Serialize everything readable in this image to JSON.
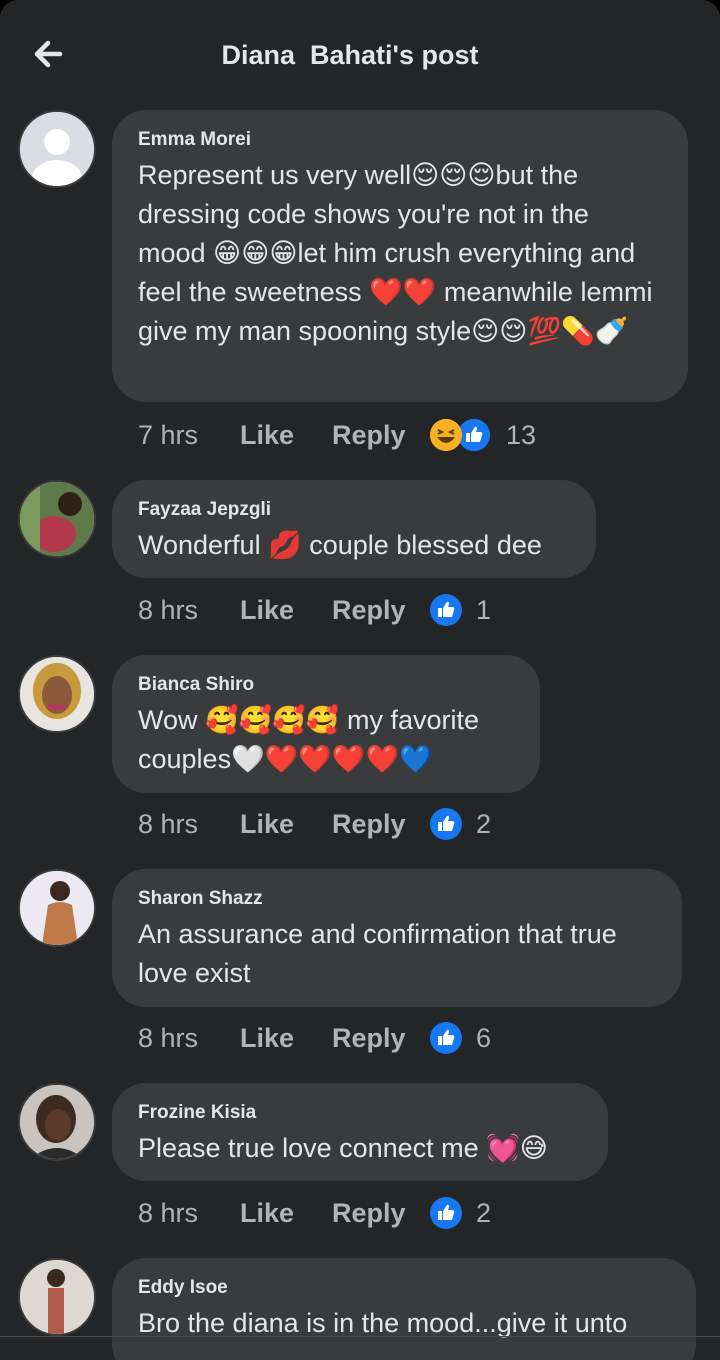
{
  "header": {
    "title": "Diana  Bahati's post"
  },
  "labels": {
    "like": "Like",
    "reply": "Reply"
  },
  "colors": {
    "background": "#242526",
    "bubble": "#3a3b3c",
    "like_blue": "#1877f2",
    "heart_red": "#f02849",
    "muted_text": "#b0b3b8"
  },
  "comments": [
    {
      "author": "Emma Morei",
      "text": "Represent us very well😌😌😌but the dressing code shows you're not in the mood 😁😁😁let him crush everything and feel the sweetness ❤️❤️ meanwhile lemmi give my man spooning style😌😌💯💊🍼",
      "time": "7 hrs",
      "reactions": [
        "haha-icon",
        "like-icon"
      ],
      "reaction_count": "13"
    },
    {
      "author": "Fayzaa Jepzgli",
      "text": "Wonderful 💋 couple blessed dee",
      "time": "8 hrs",
      "reactions": [
        "like-icon"
      ],
      "reaction_count": "1"
    },
    {
      "author": "Bianca Shiro",
      "text": "Wow 🥰🥰🥰🥰 my favorite couples🤍❤️❤️❤️❤️💙",
      "time": "8 hrs",
      "reactions": [
        "like-icon"
      ],
      "reaction_count": "2"
    },
    {
      "author": "Sharon Shazz",
      "text": "An assurance and confirmation that true love exist",
      "time": "8 hrs",
      "reactions": [
        "like-icon"
      ],
      "reaction_count": "6"
    },
    {
      "author": "Frozine Kisia",
      "text": "Please true love connect me 💓😅",
      "time": "8 hrs",
      "reactions": [
        "like-icon"
      ],
      "reaction_count": "2"
    },
    {
      "author": "Eddy Isoe",
      "text": "Bro the diana is in the mood...give it unto",
      "time": "",
      "reactions": [],
      "reaction_count": ""
    }
  ]
}
